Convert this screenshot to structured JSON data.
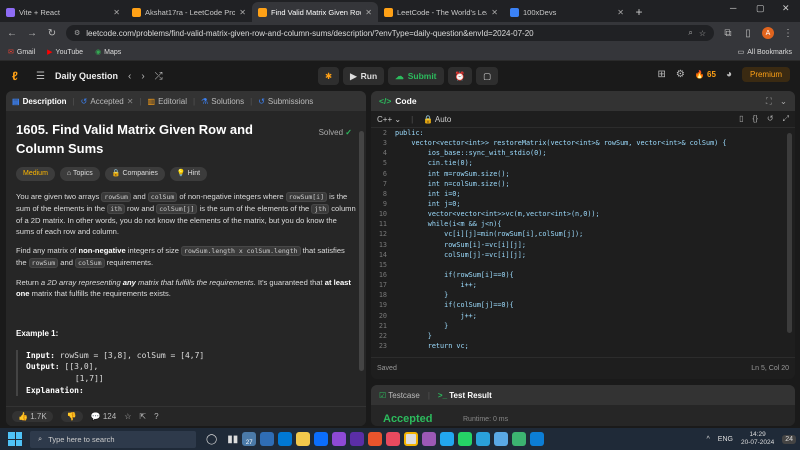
{
  "browser": {
    "tabs": [
      {
        "title": "Vite + React",
        "color": "#8e6cf5",
        "active": false
      },
      {
        "title": "Akshat17ra - LeetCode Profile",
        "color": "#ffa116",
        "active": false
      },
      {
        "title": "Find Valid Matrix Given Row an",
        "color": "#ffa116",
        "active": true
      },
      {
        "title": "LeetCode - The World's Leadin",
        "color": "#ffa116",
        "active": false
      },
      {
        "title": "100xDevs",
        "color": "#3b82f6",
        "active": false
      }
    ],
    "url": "leetcode.com/problems/find-valid-matrix-given-row-and-column-sums/description/?envType=daily-question&envId=2024-07-20",
    "avatar_letter": "A",
    "bookmarks": [
      "Gmail",
      "YouTube",
      "Maps"
    ],
    "all_bookmarks": "All Bookmarks"
  },
  "nav": {
    "daily_question": "Daily Question",
    "run": "Run",
    "submit": "Submit",
    "streak": "65",
    "premium": "Premium"
  },
  "left_tabs": [
    "Description",
    "Accepted",
    "Editorial",
    "Solutions",
    "Submissions"
  ],
  "problem": {
    "title": "1605. Find Valid Matrix Given Row and Column Sums",
    "status": "Solved",
    "chips": [
      "Medium",
      "Topics",
      "Companies",
      "Hint"
    ],
    "p1": {
      "t1": "You are given two arrays ",
      "c1": "rowSum",
      "t2": " and ",
      "c2": "colSum",
      "t3": " of non-negative integers where ",
      "c3": "rowSum[i]",
      "t4": " is the sum of the elements in the ",
      "t5": "ith",
      "t6": " row and ",
      "c4": "colSum[j]",
      "t7": " is the sum of the elements of the ",
      "t8": "jth",
      "t9": " column of a 2D matrix. In other words, you do not know the elements of the matrix, but you do know the sums of each row and column."
    },
    "p2": {
      "t1": "Find any matrix of ",
      "b1": "non-negative",
      "t2": " integers of size ",
      "c1": "rowSum.length x colSum.length",
      "t3": " that satisfies the ",
      "c2": "rowSum",
      "t4": " and ",
      "c3": "colSum",
      "t5": " requirements."
    },
    "p3": {
      "t1": "Return ",
      "i1": "a 2D array representing ",
      "bi": "any",
      "i2": " matrix that fulfills the requirements",
      "t2": ". It's guaranteed that ",
      "b1": "at least one",
      "t3": " matrix that fulfills the requirements exists."
    },
    "example_title": "Example 1:",
    "example": {
      "input_label": "Input:",
      "input": "rowSum = [3,8], colSum = [4,7]",
      "output_label": "Output:",
      "output1": "[[3,0],",
      "output2": " [1,7]]",
      "explanation_label": "Explanation:"
    },
    "likes": "1.7K",
    "comments": "124"
  },
  "code_panel": {
    "title": "Code",
    "language": "C++",
    "autosave": "Auto",
    "lines": [
      {
        "n": "2",
        "text": "public:"
      },
      {
        "n": "3",
        "text": "    vector<vector<int>> restoreMatrix(vector<int>& rowSum, vector<int>& colSum) {"
      },
      {
        "n": "4",
        "text": "        ios_base::sync_with_stdio(0);"
      },
      {
        "n": "5",
        "text": "        cin.tie(0);"
      },
      {
        "n": "6",
        "text": "        int m=rowSum.size();"
      },
      {
        "n": "7",
        "text": "        int n=colSum.size();"
      },
      {
        "n": "8",
        "text": "        int i=0;"
      },
      {
        "n": "9",
        "text": "        int j=0;"
      },
      {
        "n": "10",
        "text": "        vector<vector<int>>vc(m,vector<int>(n,0));"
      },
      {
        "n": "11",
        "text": "        while(i<m && j<n){"
      },
      {
        "n": "12",
        "text": "            vc[i][j]=min(rowSum[i],colSum[j]);"
      },
      {
        "n": "13",
        "text": "            rowSum[i]-=vc[i][j];"
      },
      {
        "n": "14",
        "text": "            colSum[j]-=vc[i][j];"
      },
      {
        "n": "15",
        "text": ""
      },
      {
        "n": "16",
        "text": "            if(rowSum[i]==0){"
      },
      {
        "n": "17",
        "text": "                i++;"
      },
      {
        "n": "18",
        "text": "            }"
      },
      {
        "n": "19",
        "text": "            if(colSum[j]==0){"
      },
      {
        "n": "20",
        "text": "                j++;"
      },
      {
        "n": "21",
        "text": "            }"
      },
      {
        "n": "22",
        "text": "        }"
      },
      {
        "n": "23",
        "text": "        return vc;"
      }
    ],
    "saved": "Saved",
    "cursor": "Ln 5, Col 20"
  },
  "console": {
    "testcase": "Testcase",
    "result": "Test Result",
    "accepted": "Accepted",
    "runtime": "Runtime: 0 ms"
  },
  "taskbar": {
    "search_placeholder": "Type here to search",
    "lang": "ENG",
    "time": "14:29",
    "date": "20-07-2024",
    "weather_badge": "27",
    "notif": "24"
  }
}
